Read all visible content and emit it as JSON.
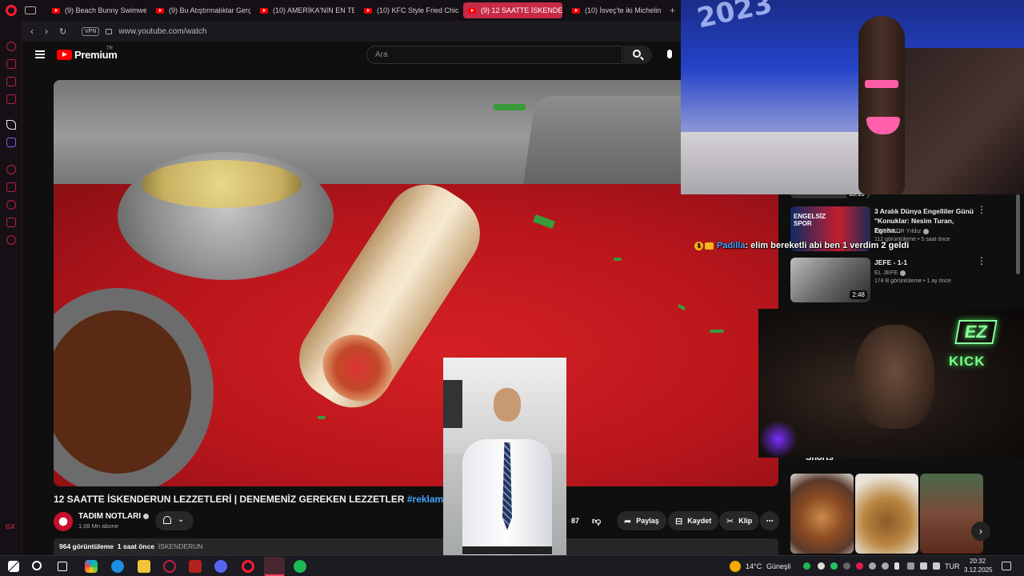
{
  "browser": {
    "tabs": [
      {
        "label": "(9) Beach Bunny Swimwea",
        "active": false
      },
      {
        "label": "(9) Bu Atıştırmalıklar Gerç",
        "active": false
      },
      {
        "label": "(10) AMERİKA'NIN EN TE",
        "active": false
      },
      {
        "label": "(10) KFC Style Fried Chick",
        "active": false
      },
      {
        "label": "(9) 12 SAATTE İSKENDER",
        "active": true
      },
      {
        "label": "(10) İsveç'te iki Michelin y",
        "active": false
      }
    ],
    "new_tab": "+",
    "vpn_label": "VPN",
    "url": "www.youtube.com/watch",
    "sidebar_gx": "GX"
  },
  "youtube": {
    "logo_text": "Premium",
    "logo_sup": "TR",
    "search_placeholder": "Ara"
  },
  "overlay_chat": {
    "badge": "1",
    "user": "Padilla",
    "message": ": elim bereketli abi ben 1 verdim 2 geldi"
  },
  "overlay_cam": {
    "neon_ez": "EZ",
    "neon_kick": "KICK"
  },
  "overlay_fashion": {
    "banner_text": "2023"
  },
  "video": {
    "title_main": "12 SAATTE İSKENDERUN LEZZETLERİ | DENEMENİZ GEREKEN LEZZETLER",
    "title_tag": "#reklam",
    "channel": "TADIM NOTLARI",
    "subscribers": "1,08 Mn abone",
    "like_count": "87",
    "share_label": "Paylaş",
    "save_label": "Kaydet",
    "clip_label": "Klip",
    "views": "964 görüntüleme",
    "age": "1 saat önce",
    "hashtag_desc": "İSKENDERUN"
  },
  "recommendations": [
    {
      "title": "",
      "channel": "",
      "meta": "",
      "duration": "18:19"
    },
    {
      "title": "3 Aralık Dünya Engelliler Günü \"Konuklar: Nesim Turan, Egeha...",
      "channel": "TRT SPOR Yıldız",
      "meta": "112 görüntüleme • 5 saat önce",
      "duration": "",
      "thumb_text": "ENGELSİZ SPOR"
    },
    {
      "title": "JEFE - 1-1",
      "channel": "EL JEFE",
      "meta": "174 B görüntüleme • 1 ay önce",
      "duration": "2:48"
    }
  ],
  "shorts": {
    "label": "Shorts",
    "next": "›"
  },
  "taskbar": {
    "weather_temp": "14°C",
    "weather_desc": "Güneşli",
    "lang": "TUR",
    "time": "20:32",
    "date": "3.12.2025"
  },
  "colors": {
    "opera_red": "#ff1b2d",
    "yt_red": "#ff0000",
    "active_tab": "#c62a47",
    "link_blue": "#3ea6ff",
    "neon_green": "#7dff8c"
  }
}
